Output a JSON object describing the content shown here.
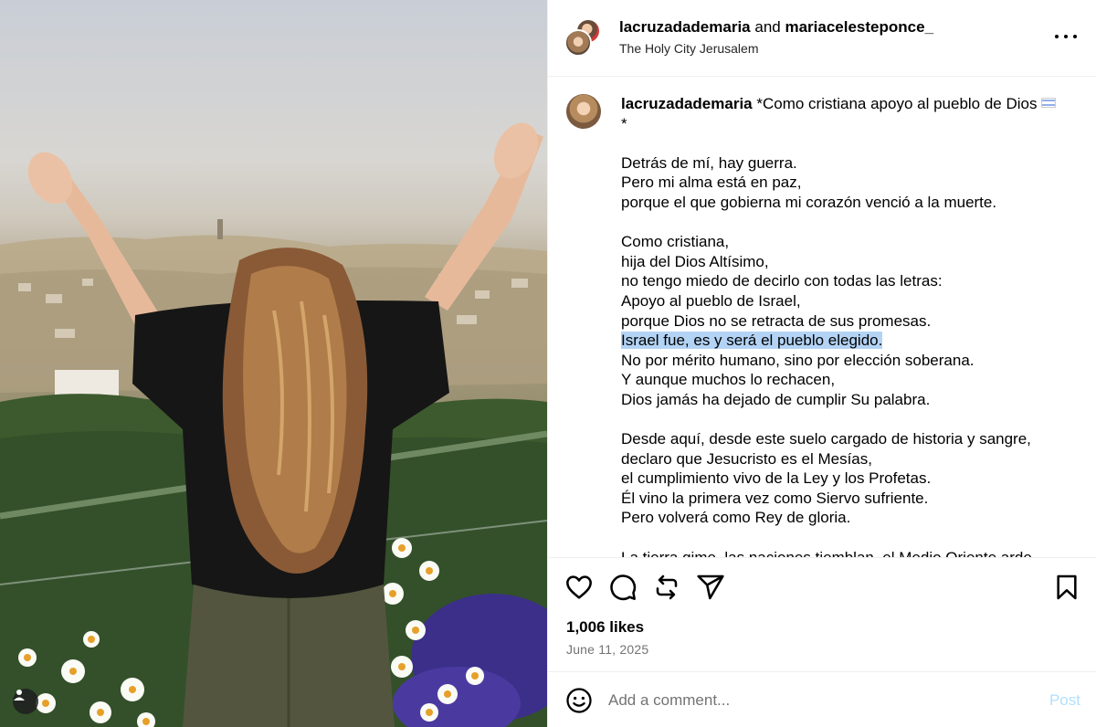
{
  "header": {
    "user1": "lacruzadademaria",
    "connector": "and",
    "user2": "mariacelesteponce_",
    "location": "The Holy City Jerusalem"
  },
  "caption": {
    "username": "lacruzadademaria",
    "first_line": "*Como cristiana apoyo al pueblo de Dios",
    "first_line_end": "*",
    "paragraph1": [
      "Detrás de mí, hay guerra.",
      "Pero mi alma está en paz,",
      "porque el que gobierna mi corazón venció a la muerte."
    ],
    "paragraph2": [
      "Como cristiana,",
      "hija del Dios Altísimo,",
      "no tengo miedo de decirlo con todas las letras:",
      "Apoyo al pueblo de Israel,",
      "porque Dios no se retracta de sus promesas."
    ],
    "highlighted": "Israel fue, es y será el pueblo elegido.",
    "paragraph2_rest": [
      "No por mérito humano, sino por elección soberana.",
      "Y aunque muchos lo rechacen,",
      "Dios jamás ha dejado de cumplir Su palabra."
    ],
    "paragraph3": [
      "Desde aquí, desde este suelo cargado de historia y sangre,",
      "declaro que Jesucristo es el Mesías,",
      "el cumplimiento vivo de la Ley y los Profetas.",
      "Él vino la primera vez como Siervo sufriente.",
      "Pero volverá como Rey de gloria."
    ],
    "paragraph4_cut": "La tierra gime, las naciones tiemblan, el Medio Oriente arde"
  },
  "icons": {
    "like": "heart-icon",
    "comment": "comment-icon",
    "share_repost": "repost-icon",
    "send": "send-icon",
    "save": "bookmark-icon",
    "emoji": "emoji-icon",
    "more": "more-icon",
    "user_tag": "user-tag-icon"
  },
  "stats": {
    "likes": "1,006 likes",
    "date": "June 11, 2025"
  },
  "comment": {
    "placeholder": "Add a comment...",
    "post_label": "Post"
  },
  "colors": {
    "highlight": "#b3d3f5",
    "post_disabled": "#b2dffc",
    "muted_text": "#737373",
    "divider": "#efefef"
  }
}
